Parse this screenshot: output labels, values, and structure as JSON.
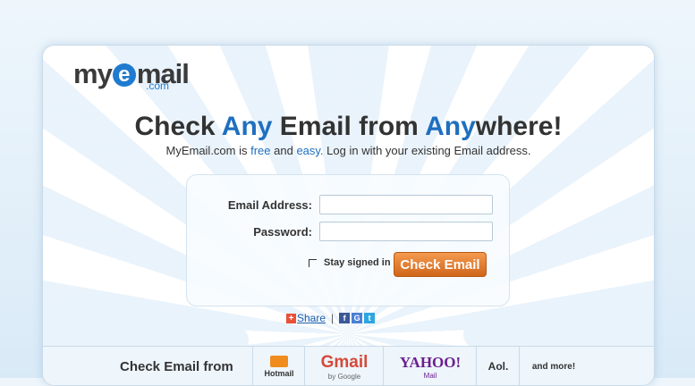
{
  "logo": {
    "my": "my",
    "e": "e",
    "mail": "mail",
    "com": ".com"
  },
  "headline": {
    "part1": "Check ",
    "any": "Any",
    "part2": " Email from ",
    "any2": "Any",
    "part3": "where!"
  },
  "subline": {
    "part1": "MyEmail.com is ",
    "free": "free",
    "part2": " and ",
    "easy": "easy.",
    "part3": " Log in with your existing Email address."
  },
  "form": {
    "email_label": "Email Address:",
    "email_value": "",
    "password_label": "Password:",
    "password_value": "",
    "stay_signed_in": "Stay signed in",
    "submit_label": "Check Email"
  },
  "share": {
    "plus": "+",
    "label": "Share",
    "separator": "|",
    "icons": [
      "facebook-icon",
      "google-icon",
      "twitter-icon"
    ],
    "facebook": "f",
    "google": "G",
    "twitter": "t"
  },
  "bottom": {
    "label": "Check Email from",
    "providers": [
      {
        "name": "Hotmail",
        "sub": ""
      },
      {
        "name": "Gmail",
        "sub": "by Google"
      },
      {
        "name": "YAHOO!",
        "sub": "Mail"
      },
      {
        "name": "Aol.",
        "sub": ""
      },
      {
        "name": "and more!",
        "sub": ""
      }
    ]
  },
  "colors": {
    "accent": "#1f6fbf",
    "button": "#e07a2a"
  }
}
